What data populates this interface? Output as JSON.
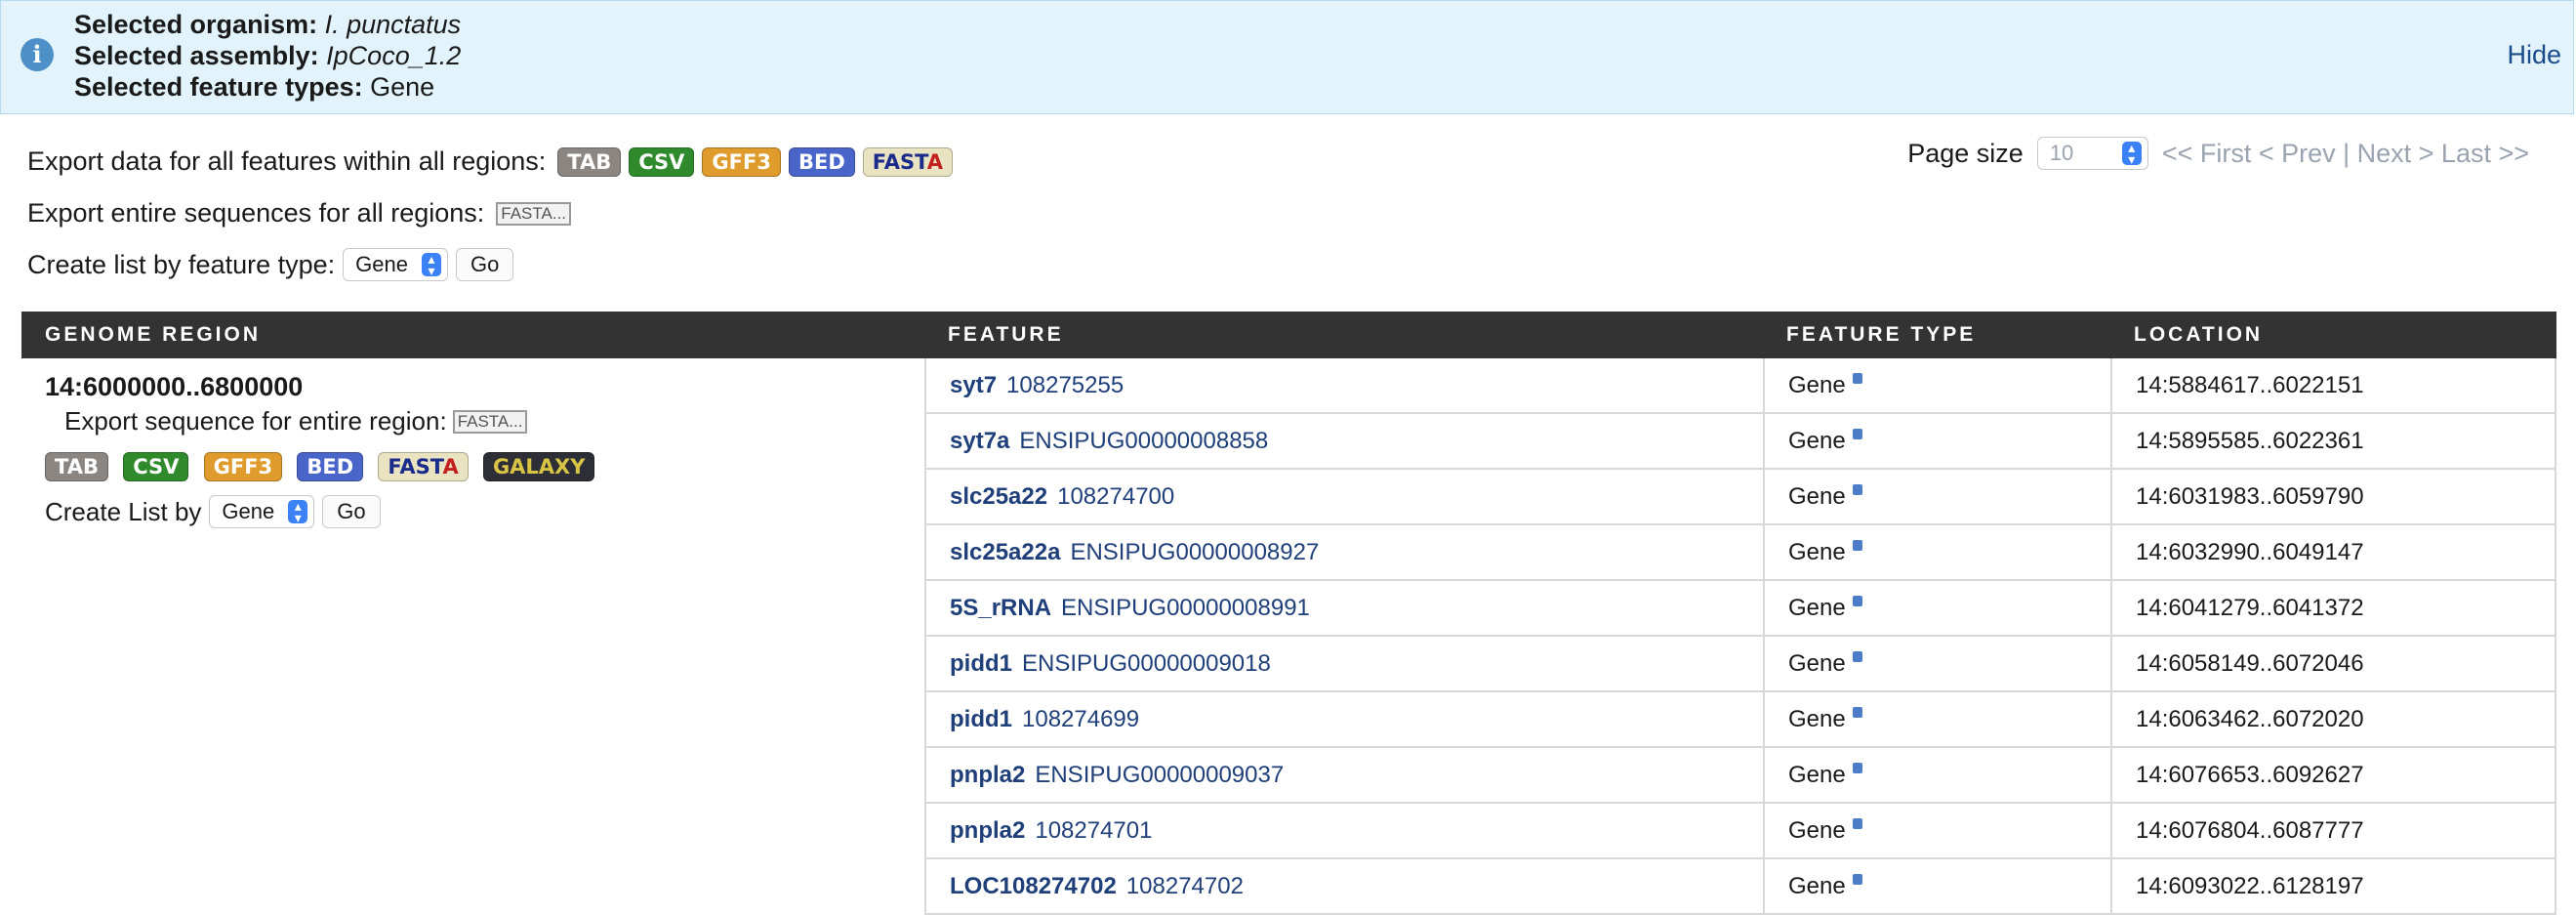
{
  "banner": {
    "organism_label": "Selected organism:",
    "organism_value": "I. punctatus",
    "assembly_label": "Selected assembly:",
    "assembly_value": "IpCoco_1.2",
    "feature_types_label": "Selected feature types:",
    "feature_types_value": "Gene",
    "hide_label": "Hide"
  },
  "export": {
    "all_features_label": "Export data for all features within all regions:",
    "entire_sequences_label": "Export entire sequences for all regions:",
    "fasta_small": "FASTA...",
    "create_list_label": "Create list by feature type:",
    "create_list_value": "Gene",
    "go_label": "Go",
    "badges": {
      "tab": "TAB",
      "csv": "CSV",
      "gff3": "GFF3",
      "bed": "BED",
      "fasta_fast": "FAST",
      "fasta_a": "A",
      "galaxy": "GALAXY"
    }
  },
  "pager": {
    "page_size_label": "Page size",
    "page_size_value": "10",
    "nav": "<< First < Prev | Next > Last >>"
  },
  "table": {
    "headers": {
      "region": "GENOME REGION",
      "feature": "FEATURE",
      "type": "FEATURE TYPE",
      "location": "LOCATION"
    },
    "region": {
      "title": "14:6000000..6800000",
      "export_label": "Export sequence for entire region:",
      "fasta_small": "FASTA...",
      "create_list_label": "Create List by",
      "create_list_value": "Gene",
      "go_label": "Go"
    },
    "rows": [
      {
        "symbol": "syt7",
        "id": "108275255",
        "type": "Gene",
        "location": "14:5884617..6022151"
      },
      {
        "symbol": "syt7a",
        "id": "ENSIPUG00000008858",
        "type": "Gene",
        "location": "14:5895585..6022361"
      },
      {
        "symbol": "slc25a22",
        "id": "108274700",
        "type": "Gene",
        "location": "14:6031983..6059790"
      },
      {
        "symbol": "slc25a22a",
        "id": "ENSIPUG00000008927",
        "type": "Gene",
        "location": "14:6032990..6049147"
      },
      {
        "symbol": "5S_rRNA",
        "id": "ENSIPUG00000008991",
        "type": "Gene",
        "location": "14:6041279..6041372"
      },
      {
        "symbol": "pidd1",
        "id": "ENSIPUG00000009018",
        "type": "Gene",
        "location": "14:6058149..6072046"
      },
      {
        "symbol": "pidd1",
        "id": "108274699",
        "type": "Gene",
        "location": "14:6063462..6072020"
      },
      {
        "symbol": "pnpla2",
        "id": "ENSIPUG00000009037",
        "type": "Gene",
        "location": "14:6076653..6092627"
      },
      {
        "symbol": "pnpla2",
        "id": "108274701",
        "type": "Gene",
        "location": "14:6076804..6087777"
      },
      {
        "symbol": "LOC108274702",
        "id": "108274702",
        "type": "Gene",
        "location": "14:6093022..6128197"
      }
    ]
  }
}
